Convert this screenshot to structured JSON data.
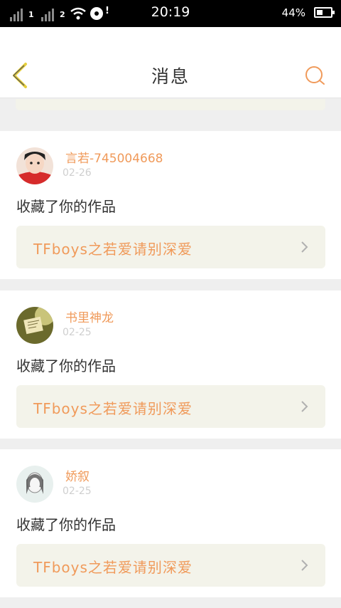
{
  "status_bar": {
    "sim1": "1",
    "sim2": "2",
    "time": "20:19",
    "battery_percent": "44%",
    "battery_level": 0.44
  },
  "header": {
    "title": "消息",
    "back_icon": "chevron-left-icon",
    "search_icon": "search-icon"
  },
  "colors": {
    "accent": "#f09a5a",
    "back_icon": "#e6cf3c",
    "card_box": "#f3f3ea",
    "background": "#efefef"
  },
  "messages": [
    {
      "username": "言若-745004668",
      "date": "02-26",
      "action": "收藏了你的作品",
      "work_title": "TFboys之若爱请别深爱"
    },
    {
      "username": "书里神龙",
      "date": "02-25",
      "action": "收藏了你的作品",
      "work_title": "TFboys之若爱请别深爱"
    },
    {
      "username": "娇叙",
      "date": "02-25",
      "action": "收藏了你的作品",
      "work_title": "TFboys之若爱请别深爱"
    }
  ]
}
